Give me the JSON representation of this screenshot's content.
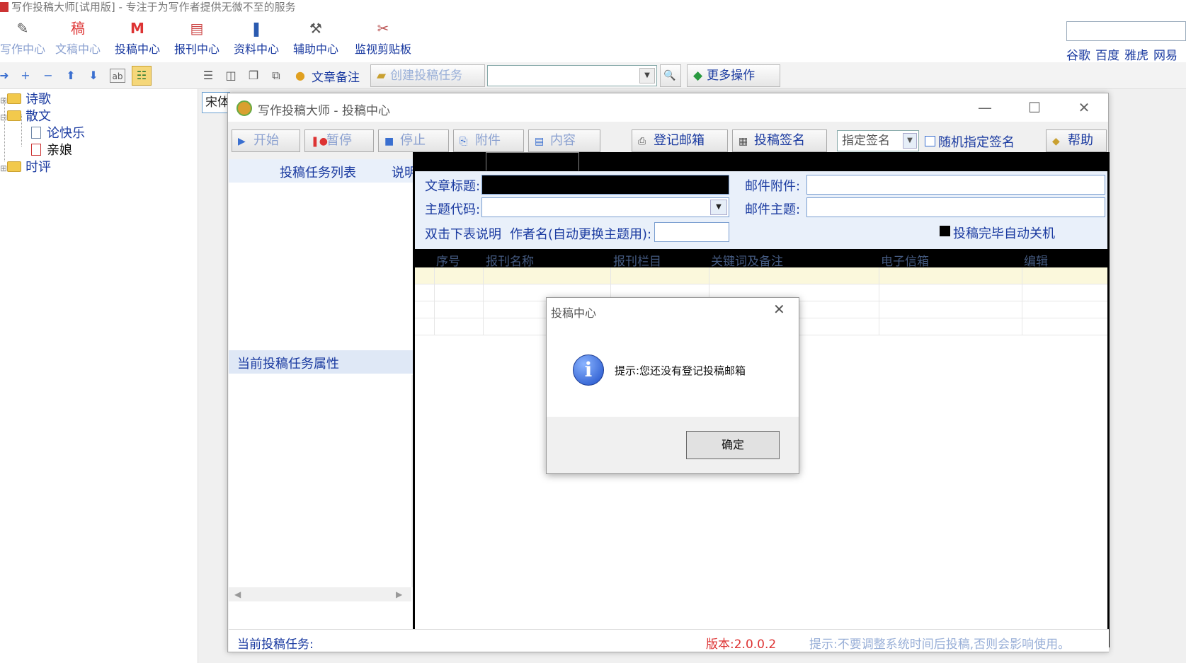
{
  "main": {
    "title": "写作投稿大师[试用版] - 专注于为写作者提供无微不至的服务",
    "ribbon": [
      {
        "label": "写作中心",
        "icon": "✎"
      },
      {
        "label": "文稿中心",
        "icon": "稿"
      },
      {
        "label": "投稿中心",
        "icon": "M"
      },
      {
        "label": "报刊中心",
        "icon": "▤"
      },
      {
        "label": "资料中心",
        "icon": "❚"
      },
      {
        "label": "辅助中心",
        "icon": "⚒"
      },
      {
        "label": "监视剪贴板",
        "icon": "✂"
      }
    ],
    "links": [
      "谷歌",
      "百度",
      "雅虎",
      "网易"
    ],
    "toolbar": {
      "note": "文章备注",
      "create_task": "创建投稿任务",
      "more": "更多操作",
      "font": "宋体"
    },
    "tree": {
      "poetry": "诗歌",
      "prose": "散文",
      "doc1": "论快乐",
      "doc2": "亲娘",
      "commentary": "时评"
    }
  },
  "dialog": {
    "title": "写作投稿大师 - 投稿中心",
    "toolbar": {
      "start": "开始",
      "pause": "暂停",
      "stop": "停止",
      "attach": "附件",
      "content": "内容",
      "register_mail": "登记邮箱",
      "sign": "投稿签名",
      "sign_select": "指定签名",
      "random_sign": "随机指定签名",
      "help": "帮助"
    },
    "left": {
      "task_list": "投稿任务列表",
      "explain": "说明",
      "task_props": "当前投稿任务属性"
    },
    "form": {
      "article_title": "文章标题:",
      "mail_attach": "邮件附件:",
      "topic_code": "主题代码:",
      "mail_subject": "邮件主题:",
      "dblclick": "双击下表说明",
      "author_name": "作者名(自动更换主题用):",
      "auto_shutdown": "投稿完毕自动关机"
    },
    "grid_columns": [
      "序号",
      "报刊名称",
      "报刊栏目",
      "关键词及备注",
      "电子信箱",
      "编辑"
    ],
    "status": {
      "current_task": "当前投稿任务:",
      "version": "版本:2.0.0.2",
      "tip": "提示:不要调整系统时间后投稿,否则会影响使用。"
    }
  },
  "msgbox": {
    "title": "投稿中心",
    "message": "提示:您还没有登记投稿邮箱",
    "ok": "确定"
  }
}
